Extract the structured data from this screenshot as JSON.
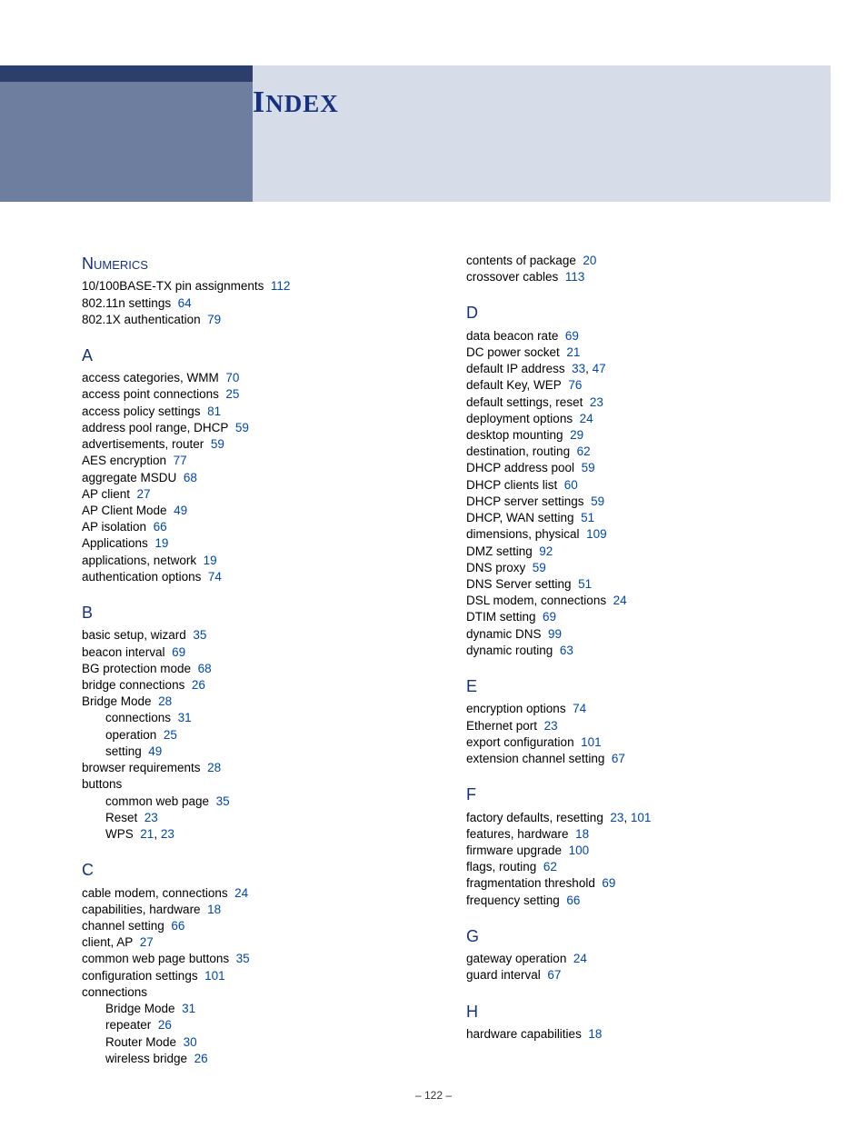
{
  "title_main": "I",
  "title_rest": "NDEX",
  "page_number": "122",
  "col1": [
    {
      "type": "heading",
      "text_main": "N",
      "text_rest": "UMERICS"
    },
    {
      "type": "entry",
      "text": "10/100BASE-TX pin assignments",
      "pages": [
        "112"
      ]
    },
    {
      "type": "entry",
      "text": "802.11n settings",
      "pages": [
        "64"
      ]
    },
    {
      "type": "entry",
      "text": "802.1X authentication",
      "pages": [
        "79"
      ]
    },
    {
      "type": "heading",
      "text_main": "A"
    },
    {
      "type": "entry",
      "text": "access categories, WMM",
      "pages": [
        "70"
      ]
    },
    {
      "type": "entry",
      "text": "access point connections",
      "pages": [
        "25"
      ]
    },
    {
      "type": "entry",
      "text": "access policy settings",
      "pages": [
        "81"
      ]
    },
    {
      "type": "entry",
      "text": "address pool range, DHCP",
      "pages": [
        "59"
      ]
    },
    {
      "type": "entry",
      "text": "advertisements, router",
      "pages": [
        "59"
      ]
    },
    {
      "type": "entry",
      "text": "AES encryption",
      "pages": [
        "77"
      ]
    },
    {
      "type": "entry",
      "text": "aggregate MSDU",
      "pages": [
        "68"
      ]
    },
    {
      "type": "entry",
      "text": "AP client",
      "pages": [
        "27"
      ]
    },
    {
      "type": "entry",
      "text": "AP Client Mode",
      "pages": [
        "49"
      ]
    },
    {
      "type": "entry",
      "text": "AP isolation",
      "pages": [
        "66"
      ]
    },
    {
      "type": "entry",
      "text": "Applications",
      "pages": [
        "19"
      ]
    },
    {
      "type": "entry",
      "text": "applications, network",
      "pages": [
        "19"
      ]
    },
    {
      "type": "entry",
      "text": "authentication options",
      "pages": [
        "74"
      ]
    },
    {
      "type": "heading",
      "text_main": "B"
    },
    {
      "type": "entry",
      "text": "basic setup, wizard",
      "pages": [
        "35"
      ]
    },
    {
      "type": "entry",
      "text": "beacon interval",
      "pages": [
        "69"
      ]
    },
    {
      "type": "entry",
      "text": "BG protection mode",
      "pages": [
        "68"
      ]
    },
    {
      "type": "entry",
      "text": "bridge connections",
      "pages": [
        "26"
      ]
    },
    {
      "type": "entry",
      "text": "Bridge Mode",
      "pages": [
        "28"
      ]
    },
    {
      "type": "sub",
      "text": "connections",
      "pages": [
        "31"
      ]
    },
    {
      "type": "sub",
      "text": "operation",
      "pages": [
        "25"
      ]
    },
    {
      "type": "sub",
      "text": "setting",
      "pages": [
        "49"
      ]
    },
    {
      "type": "entry",
      "text": "browser requirements",
      "pages": [
        "28"
      ]
    },
    {
      "type": "entry",
      "text": "buttons",
      "pages": []
    },
    {
      "type": "sub",
      "text": "common web page",
      "pages": [
        "35"
      ]
    },
    {
      "type": "sub",
      "text": "Reset",
      "pages": [
        "23"
      ]
    },
    {
      "type": "sub",
      "text": "WPS",
      "pages": [
        "21",
        "23"
      ]
    },
    {
      "type": "heading",
      "text_main": "C"
    },
    {
      "type": "entry",
      "text": "cable modem, connections",
      "pages": [
        "24"
      ]
    },
    {
      "type": "entry",
      "text": "capabilities, hardware",
      "pages": [
        "18"
      ]
    },
    {
      "type": "entry",
      "text": "channel setting",
      "pages": [
        "66"
      ]
    },
    {
      "type": "entry",
      "text": "client, AP",
      "pages": [
        "27"
      ]
    },
    {
      "type": "entry",
      "text": "common web page buttons",
      "pages": [
        "35"
      ]
    },
    {
      "type": "entry",
      "text": "configuration settings",
      "pages": [
        "101"
      ]
    },
    {
      "type": "entry",
      "text": "connections",
      "pages": []
    },
    {
      "type": "sub",
      "text": "Bridge Mode",
      "pages": [
        "31"
      ]
    },
    {
      "type": "sub",
      "text": "repeater",
      "pages": [
        "26"
      ]
    },
    {
      "type": "sub",
      "text": "Router Mode",
      "pages": [
        "30"
      ]
    },
    {
      "type": "sub",
      "text": "wireless bridge",
      "pages": [
        "26"
      ]
    }
  ],
  "col2": [
    {
      "type": "entry",
      "text": "contents of package",
      "pages": [
        "20"
      ]
    },
    {
      "type": "entry",
      "text": "crossover cables",
      "pages": [
        "113"
      ]
    },
    {
      "type": "heading",
      "text_main": "D"
    },
    {
      "type": "entry",
      "text": "data beacon rate",
      "pages": [
        "69"
      ]
    },
    {
      "type": "entry",
      "text": "DC power socket",
      "pages": [
        "21"
      ]
    },
    {
      "type": "entry",
      "text": "default IP address",
      "pages": [
        "33",
        "47"
      ]
    },
    {
      "type": "entry",
      "text": "default Key, WEP",
      "pages": [
        "76"
      ]
    },
    {
      "type": "entry",
      "text": "default settings, reset",
      "pages": [
        "23"
      ]
    },
    {
      "type": "entry",
      "text": "deployment options",
      "pages": [
        "24"
      ]
    },
    {
      "type": "entry",
      "text": "desktop mounting",
      "pages": [
        "29"
      ]
    },
    {
      "type": "entry",
      "text": "destination, routing",
      "pages": [
        "62"
      ]
    },
    {
      "type": "entry",
      "text": "DHCP address pool",
      "pages": [
        "59"
      ]
    },
    {
      "type": "entry",
      "text": "DHCP clients list",
      "pages": [
        "60"
      ]
    },
    {
      "type": "entry",
      "text": "DHCP server settings",
      "pages": [
        "59"
      ]
    },
    {
      "type": "entry",
      "text": "DHCP, WAN setting",
      "pages": [
        "51"
      ]
    },
    {
      "type": "entry",
      "text": "dimensions, physical",
      "pages": [
        "109"
      ]
    },
    {
      "type": "entry",
      "text": "DMZ setting",
      "pages": [
        "92"
      ]
    },
    {
      "type": "entry",
      "text": "DNS proxy",
      "pages": [
        "59"
      ]
    },
    {
      "type": "entry",
      "text": "DNS Server setting",
      "pages": [
        "51"
      ]
    },
    {
      "type": "entry",
      "text": "DSL modem, connections",
      "pages": [
        "24"
      ]
    },
    {
      "type": "entry",
      "text": "DTIM setting",
      "pages": [
        "69"
      ]
    },
    {
      "type": "entry",
      "text": "dynamic DNS",
      "pages": [
        "99"
      ]
    },
    {
      "type": "entry",
      "text": "dynamic routing",
      "pages": [
        "63"
      ]
    },
    {
      "type": "heading",
      "text_main": "E"
    },
    {
      "type": "entry",
      "text": "encryption options",
      "pages": [
        "74"
      ]
    },
    {
      "type": "entry",
      "text": "Ethernet port",
      "pages": [
        "23"
      ]
    },
    {
      "type": "entry",
      "text": "export configuration",
      "pages": [
        "101"
      ]
    },
    {
      "type": "entry",
      "text": "extension channel setting",
      "pages": [
        "67"
      ]
    },
    {
      "type": "heading",
      "text_main": "F"
    },
    {
      "type": "entry",
      "text": "factory defaults, resetting",
      "pages": [
        "23",
        "101"
      ]
    },
    {
      "type": "entry",
      "text": "features, hardware",
      "pages": [
        "18"
      ]
    },
    {
      "type": "entry",
      "text": "firmware upgrade",
      "pages": [
        "100"
      ]
    },
    {
      "type": "entry",
      "text": "flags, routing",
      "pages": [
        "62"
      ]
    },
    {
      "type": "entry",
      "text": "fragmentation threshold",
      "pages": [
        "69"
      ]
    },
    {
      "type": "entry",
      "text": "frequency setting",
      "pages": [
        "66"
      ]
    },
    {
      "type": "heading",
      "text_main": "G"
    },
    {
      "type": "entry",
      "text": "gateway operation",
      "pages": [
        "24"
      ]
    },
    {
      "type": "entry",
      "text": "guard interval",
      "pages": [
        "67"
      ]
    },
    {
      "type": "heading",
      "text_main": "H"
    },
    {
      "type": "entry",
      "text": "hardware capabilities",
      "pages": [
        "18"
      ]
    }
  ]
}
